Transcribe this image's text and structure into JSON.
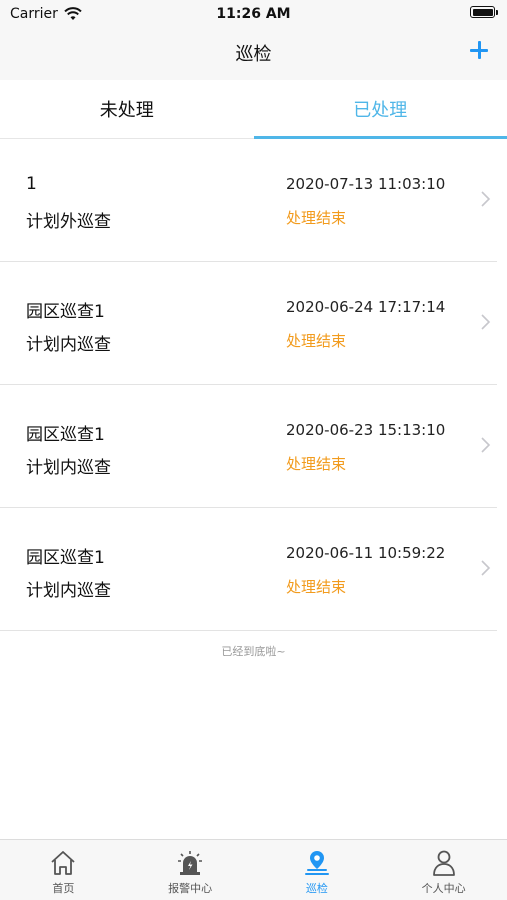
{
  "status_bar": {
    "carrier": "Carrier",
    "time": "11:26 AM"
  },
  "nav": {
    "title": "巡检"
  },
  "tabs": [
    {
      "label": "未处理",
      "active": false
    },
    {
      "label": "已处理",
      "active": true
    }
  ],
  "items": [
    {
      "title": "1",
      "type": "计划外巡查",
      "date": "2020-07-13 11:03:10",
      "status": "处理结束"
    },
    {
      "title": "园区巡查1",
      "type": "计划内巡查",
      "date": "2020-06-24 17:17:14",
      "status": "处理结束"
    },
    {
      "title": "园区巡查1",
      "type": "计划内巡查",
      "date": "2020-06-23 15:13:10",
      "status": "处理结束"
    },
    {
      "title": "园区巡查1",
      "type": "计划内巡查",
      "date": "2020-06-11 10:59:22",
      "status": "处理结束"
    }
  ],
  "list_end_text": "已经到底啦~",
  "tabbar": [
    {
      "label": "首页",
      "icon": "home-icon",
      "active": false
    },
    {
      "label": "报警中心",
      "icon": "alarm-icon",
      "active": false
    },
    {
      "label": "巡检",
      "icon": "location-pin-icon",
      "active": true
    },
    {
      "label": "个人中心",
      "icon": "person-icon",
      "active": false
    }
  ],
  "colors": {
    "accent": "#4fb6e8",
    "status": "#f29b1d",
    "tab_active": "#2196f3"
  }
}
